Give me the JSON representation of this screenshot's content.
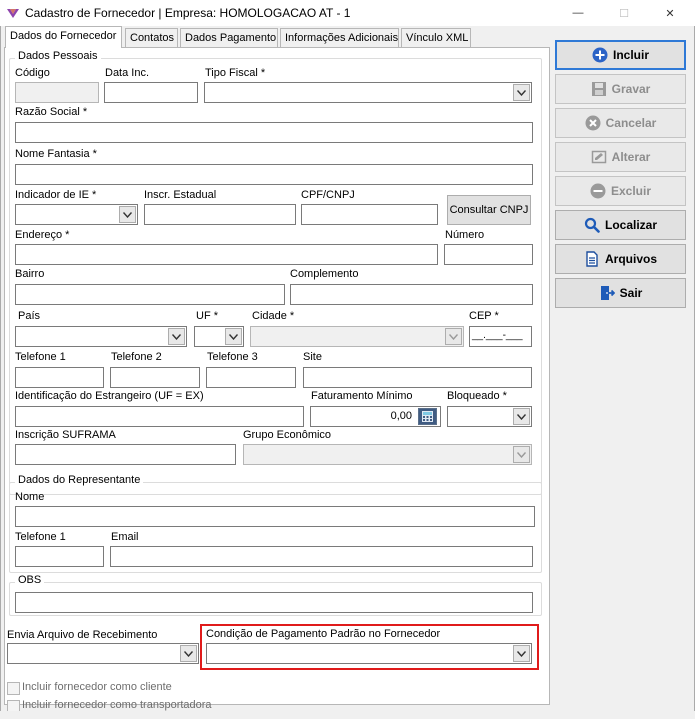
{
  "window": {
    "title": "Cadastro de Fornecedor | Empresa: HOMOLOGACAO AT - 1",
    "minimize": "—",
    "maximize": "☐",
    "close": "✕"
  },
  "tabs": [
    {
      "label": "Dados do Fornecedor"
    },
    {
      "label": "Contatos"
    },
    {
      "label": "Dados Pagamento"
    },
    {
      "label": "Informações Adicionais"
    },
    {
      "label": "Vínculo XML"
    }
  ],
  "dados_pessoais": {
    "legend": "Dados Pessoais",
    "codigo": {
      "label": "Código",
      "value": ""
    },
    "data_inc": {
      "label": "Data Inc.",
      "value": ""
    },
    "tipo_fiscal": {
      "label": "Tipo Fiscal *",
      "value": ""
    },
    "razao_social": {
      "label": "Razão Social *",
      "value": ""
    },
    "nome_fantasia": {
      "label": "Nome Fantasia *",
      "value": ""
    },
    "indicador_ie": {
      "label": "Indicador de IE *",
      "value": ""
    },
    "inscr_estadual": {
      "label": "Inscr. Estadual",
      "value": ""
    },
    "cpf_cnpj": {
      "label": "CPF/CNPJ",
      "value": ""
    },
    "consultar_cnpj": "Consultar CNPJ",
    "endereco": {
      "label": "Endereço *",
      "value": ""
    },
    "numero": {
      "label": "Número",
      "value": ""
    },
    "bairro": {
      "label": "Bairro",
      "value": ""
    },
    "complemento": {
      "label": "Complemento",
      "value": ""
    },
    "pais": {
      "label": "País",
      "value": ""
    },
    "uf": {
      "label": "UF *",
      "value": ""
    },
    "cidade": {
      "label": "Cidade *",
      "value": ""
    },
    "cep": {
      "label": "CEP *",
      "value": "__.___-___"
    },
    "telefone1": {
      "label": "Telefone 1",
      "value": ""
    },
    "telefone2": {
      "label": "Telefone 2",
      "value": ""
    },
    "telefone3": {
      "label": "Telefone 3",
      "value": ""
    },
    "site": {
      "label": "Site",
      "value": ""
    },
    "ident_estrangeiro": {
      "label": "Identificação do Estrangeiro (UF = EX)",
      "value": ""
    },
    "faturamento_minimo": {
      "label": "Faturamento Mínimo",
      "value": "0,00"
    },
    "bloqueado": {
      "label": "Bloqueado *",
      "value": ""
    },
    "inscricao_suframa": {
      "label": "Inscrição SUFRAMA",
      "value": ""
    },
    "grupo_economico": {
      "label": "Grupo Econômico",
      "value": ""
    }
  },
  "representante": {
    "legend": "Dados do Representante",
    "nome": {
      "label": "Nome",
      "value": ""
    },
    "telefone1": {
      "label": "Telefone 1",
      "value": ""
    },
    "email": {
      "label": "Email",
      "value": ""
    }
  },
  "obs": {
    "legend": "OBS",
    "value": ""
  },
  "envia_arquivo": {
    "label": "Envia Arquivo de Recebimento",
    "value": ""
  },
  "condicao_pagamento": {
    "label": "Condição de Pagamento Padrão no Fornecedor",
    "value": ""
  },
  "checkboxes": {
    "incluir_cliente": "Incluir fornecedor como cliente",
    "incluir_transportadora": "Incluir fornecedor como transportadora"
  },
  "actions": {
    "incluir": "Incluir",
    "gravar": "Gravar",
    "cancelar": "Cancelar",
    "alterar": "Alterar",
    "excluir": "Excluir",
    "localizar": "Localizar",
    "arquivos": "Arquivos",
    "sair": "Sair"
  },
  "colors": {
    "accent": "#2f79d6",
    "highlight": "#e01b1b"
  }
}
